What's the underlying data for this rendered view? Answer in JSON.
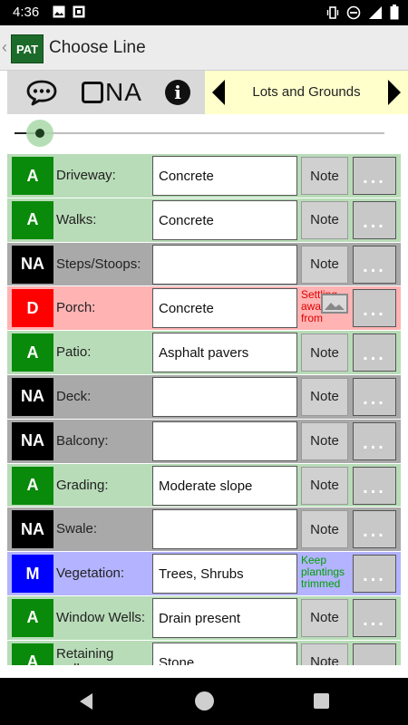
{
  "status_bar": {
    "time": "4:36",
    "left_icons": [
      "image-icon",
      "sim-icon"
    ],
    "right_icons": [
      "vibrate-icon",
      "dnd-icon",
      "signal-icon",
      "battery-icon"
    ]
  },
  "app_bar": {
    "logo_text": "PAT",
    "title": "Choose Line"
  },
  "toolbar": {
    "na_label": "NA",
    "section_name": "Lots and Grounds"
  },
  "slider": {
    "value_fraction": 0.05
  },
  "colors": {
    "A": "#0a8a0a",
    "NA": "#000000",
    "D": "#ff0000",
    "M": "#0000ff"
  },
  "rows": [
    {
      "code": "A",
      "label": "Driveway:",
      "value": "Concrete",
      "note": "Note",
      "note_type": "button",
      "more": "..."
    },
    {
      "code": "A",
      "label": "Walks:",
      "value": "Concrete",
      "note": "Note",
      "note_type": "button",
      "more": "..."
    },
    {
      "code": "NA",
      "label": "Steps/Stoops:",
      "value": "",
      "note": "Note",
      "note_type": "button",
      "more": "..."
    },
    {
      "code": "D",
      "label": "Porch:",
      "value": "Concrete",
      "note": "Settling away from",
      "note_type": "red",
      "more": "..."
    },
    {
      "code": "A",
      "label": "Patio:",
      "value": "Asphalt pavers",
      "note": "Note",
      "note_type": "button",
      "more": "..."
    },
    {
      "code": "NA",
      "label": "Deck:",
      "value": "",
      "note": "Note",
      "note_type": "button",
      "more": "..."
    },
    {
      "code": "NA",
      "label": "Balcony:",
      "value": "",
      "note": "Note",
      "note_type": "button",
      "more": "..."
    },
    {
      "code": "A",
      "label": "Grading:",
      "value": "Moderate slope",
      "note": "Note",
      "note_type": "button",
      "more": "..."
    },
    {
      "code": "NA",
      "label": "Swale:",
      "value": "",
      "note": "Note",
      "note_type": "button",
      "more": "..."
    },
    {
      "code": "M",
      "label": "Vegetation:",
      "value": "Trees, Shrubs",
      "note": "Keep plantings trimmed",
      "note_type": "green",
      "more": "..."
    },
    {
      "code": "A",
      "label": "Window Wells:",
      "value": "Drain present",
      "note": "Note",
      "note_type": "button",
      "more": "..."
    },
    {
      "code": "A",
      "label": "Retaining walls:",
      "value": "Stone",
      "note": "Note",
      "note_type": "button",
      "more": "..."
    }
  ]
}
